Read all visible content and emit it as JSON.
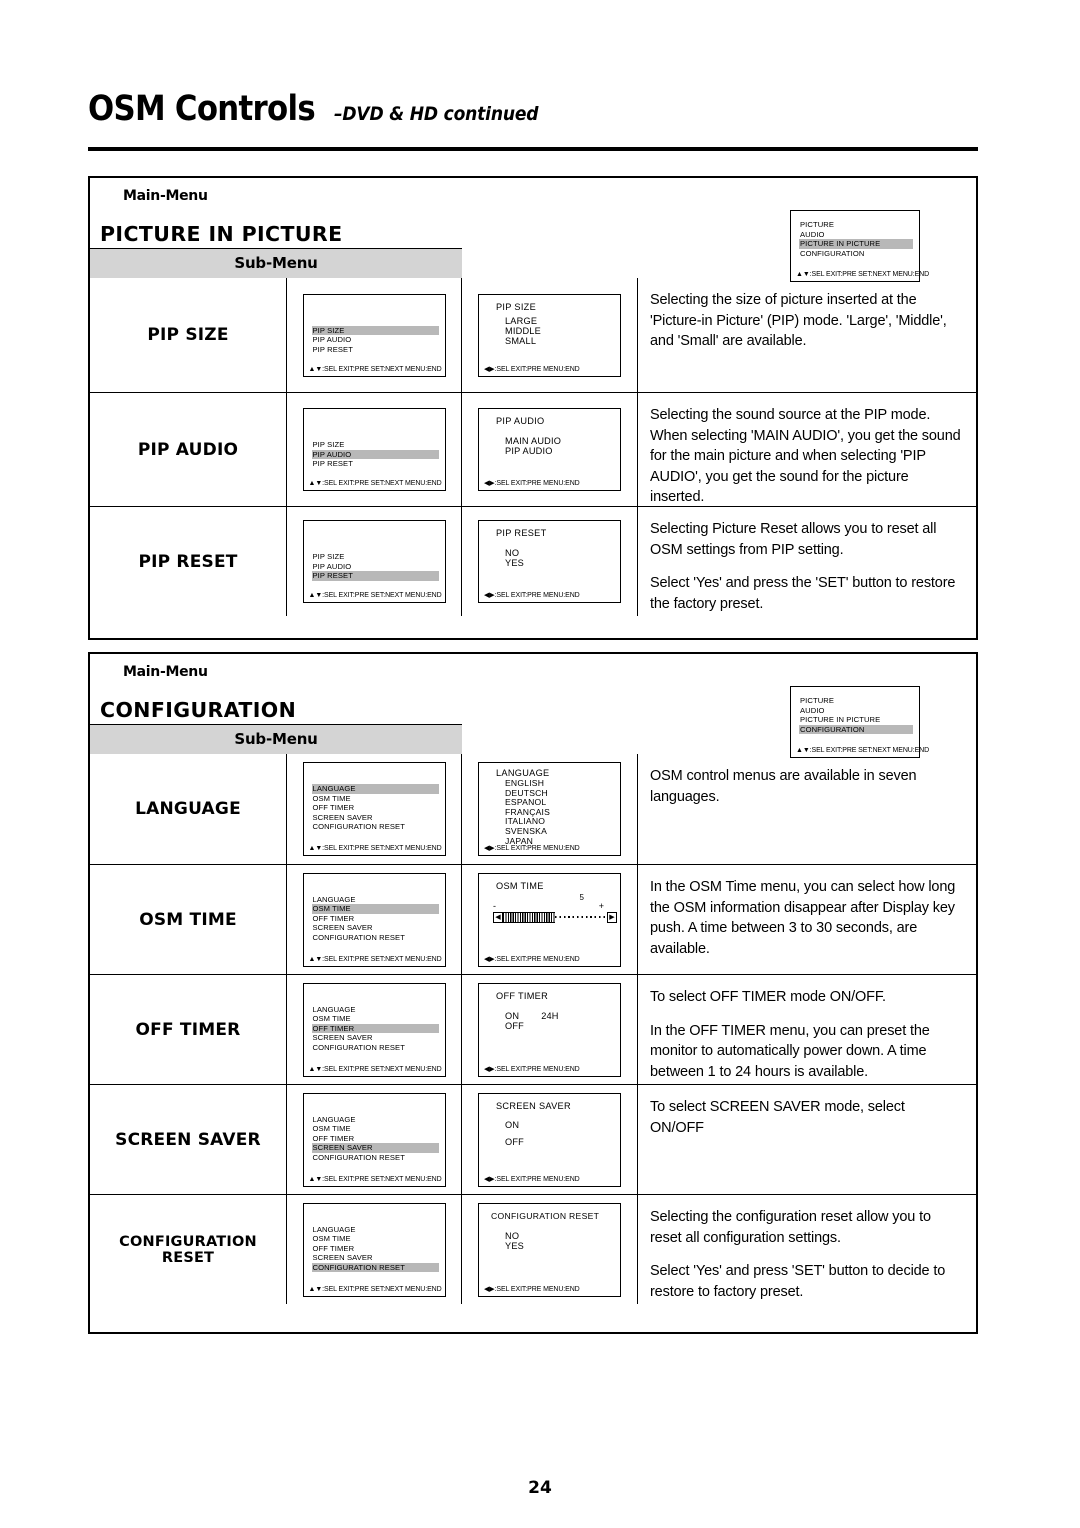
{
  "header": {
    "title_main": "OSM Controls",
    "title_sub": "–DVD & HD continued"
  },
  "footer": {
    "page_number": "24"
  },
  "labels": {
    "main_menu": "Main-Menu",
    "sub_menu": "Sub-Menu"
  },
  "osd_footers": {
    "nav_full": "▲▼:SEL EXIT:PRE SET:NEXT MENU:END",
    "nav_lr": "◀▶:SEL    EXIT:PRE     MENU:END"
  },
  "sections": [
    {
      "id": "pip",
      "title": "PICTURE IN PICTURE",
      "main_menu_osd": {
        "items": [
          "PICTURE",
          "AUDIO",
          "PICTURE IN PICTURE",
          "CONFIGURATION"
        ],
        "highlighted": "PICTURE IN PICTURE"
      },
      "rows": [
        {
          "label": "PIP SIZE",
          "osd_list": {
            "items": [
              "PIP SIZE",
              "PIP AUDIO",
              "PIP RESET"
            ],
            "highlighted": "PIP SIZE"
          },
          "osd_option": {
            "title": "PIP SIZE",
            "options": [
              "LARGE",
              "MIDDLE",
              "SMALL"
            ]
          },
          "description": [
            "Selecting the size of picture inserted at the 'Picture-in Picture' (PIP) mode. 'Large', 'Middle', and 'Small' are available."
          ]
        },
        {
          "label": "PIP AUDIO",
          "osd_list": {
            "items": [
              "PIP SIZE",
              "PIP AUDIO",
              "PIP RESET"
            ],
            "highlighted": "PIP AUDIO"
          },
          "osd_option": {
            "title": "PIP AUDIO",
            "options": [
              "MAIN AUDIO",
              "PIP AUDIO"
            ]
          },
          "description": [
            "Selecting the sound source at the PIP mode. When selecting 'MAIN AUDIO', you get the sound for the main picture and when selecting 'PIP AUDIO', you get the sound for the picture inserted."
          ]
        },
        {
          "label": "PIP RESET",
          "osd_list": {
            "items": [
              "PIP SIZE",
              "PIP AUDIO",
              "PIP RESET"
            ],
            "highlighted": "PIP RESET"
          },
          "osd_option": {
            "title": "PIP RESET",
            "options": [
              "NO",
              "YES"
            ]
          },
          "description": [
            "Selecting Picture Reset allows you to reset all OSM settings from PIP setting.",
            "Select 'Yes' and press the 'SET' button to restore the factory preset."
          ]
        }
      ]
    },
    {
      "id": "configuration",
      "title": "CONFIGURATION",
      "main_menu_osd": {
        "items": [
          "PICTURE",
          "AUDIO",
          "PICTURE IN PICTURE",
          "CONFIGURATION"
        ],
        "highlighted": "CONFIGURATION"
      },
      "rows": [
        {
          "label": "LANGUAGE",
          "osd_list": {
            "items": [
              "LANGUAGE",
              "OSM TIME",
              "OFF TIMER",
              "SCREEN SAVER",
              "CONFIGURATION RESET"
            ],
            "highlighted": "LANGUAGE"
          },
          "osd_option": {
            "title": "LANGUAGE",
            "options": [
              "ENGLISH",
              "DEUTSCH",
              "ESPANOL",
              "FRANÇAIS",
              "ITALIANO",
              "SVENSKA",
              "JAPAN"
            ]
          },
          "description": [
            "OSM control menus are available in seven languages."
          ]
        },
        {
          "label": "OSM TIME",
          "osd_list": {
            "items": [
              "LANGUAGE",
              "OSM TIME",
              "OFF TIMER",
              "SCREEN SAVER",
              "CONFIGURATION RESET"
            ],
            "highlighted": "OSM TIME"
          },
          "osd_option": {
            "title": "OSM TIME",
            "slider": {
              "value": "5",
              "minus": "-",
              "plus": "+",
              "left_arrow": "◀",
              "right_arrow": "▶"
            }
          },
          "description": [
            "In the OSM Time menu, you can select how long the OSM information disappear after Display key push. A time between 3 to 30 seconds, are available."
          ]
        },
        {
          "label": "OFF TIMER",
          "osd_list": {
            "items": [
              "LANGUAGE",
              "OSM TIME",
              "OFF TIMER",
              "SCREEN SAVER",
              "CONFIGURATION RESET"
            ],
            "highlighted": "OFF TIMER"
          },
          "osd_option": {
            "title": "OFF TIMER",
            "options": [
              "ON",
              "OFF"
            ],
            "option_value": "24H"
          },
          "description": [
            "To select OFF TIMER mode ON/OFF.",
            "In the OFF TIMER menu, you can preset the monitor to automatically power down. A time between 1 to 24 hours is available."
          ]
        },
        {
          "label": "SCREEN SAVER",
          "osd_list": {
            "items": [
              "LANGUAGE",
              "OSM TIME",
              "OFF TIMER",
              "SCREEN SAVER",
              "CONFIGURATION RESET"
            ],
            "highlighted": "SCREEN SAVER"
          },
          "osd_option": {
            "title": "SCREEN SAVER",
            "options": [
              "ON",
              "OFF"
            ]
          },
          "description": [
            "To select SCREEN SAVER mode, select ON/OFF"
          ]
        },
        {
          "label": "CONFIGURATION RESET",
          "osd_list": {
            "items": [
              "LANGUAGE",
              "OSM TIME",
              "OFF TIMER",
              "SCREEN SAVER",
              "CONFIGURATION RESET"
            ],
            "highlighted": "CONFIGURATION RESET"
          },
          "osd_option": {
            "title": "CONFIGURATION RESET",
            "options": [
              "NO",
              "YES"
            ]
          },
          "description": [
            "Selecting the configuration reset allow you to reset all configuration settings.",
            "Select 'Yes' and press 'SET' button to decide to restore to factory preset."
          ]
        }
      ]
    }
  ]
}
